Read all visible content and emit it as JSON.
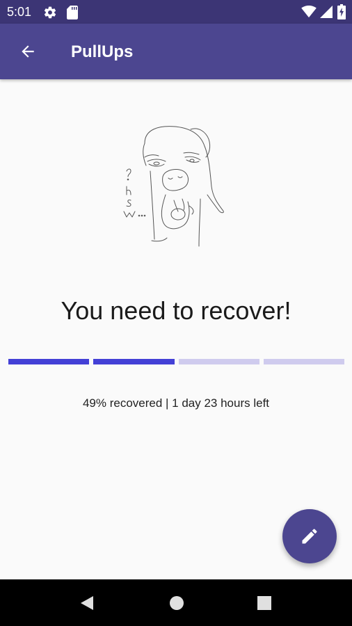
{
  "status_bar": {
    "time": "5:01",
    "icons": [
      "gear-icon",
      "sd-card-icon",
      "wifi-icon",
      "signal-icon",
      "battery-charging-icon"
    ]
  },
  "app_bar": {
    "back_icon": "arrow-back-icon",
    "title": "PullUps"
  },
  "illustration": {
    "name": "llama-sketch",
    "scribble_text": "?hs..."
  },
  "headline": "You need to recover!",
  "progress": {
    "segments_total": 4,
    "segments_filled": 2,
    "fill_color": "#4340d6",
    "empty_color": "#cfcbee"
  },
  "status_text": "49% recovered | 1 day 23 hours left",
  "fab": {
    "icon": "edit-pencil-icon"
  },
  "nav_bar": {
    "icons": [
      "nav-back-icon",
      "nav-home-icon",
      "nav-recents-icon"
    ]
  },
  "colors": {
    "status_bar": "#3c3575",
    "app_bar": "#4c4690",
    "background": "#fafafa",
    "fab": "#4c4690"
  }
}
